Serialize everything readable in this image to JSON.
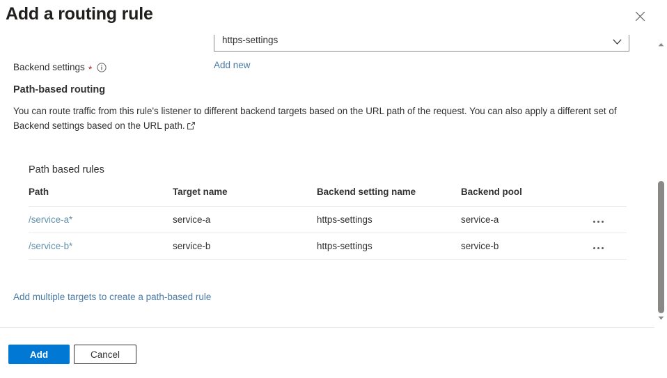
{
  "blade": {
    "title": "Add a routing rule",
    "close_icon": "close-icon"
  },
  "backend_settings": {
    "label": "Backend settings",
    "required_marker": "*",
    "info_icon": "info-icon",
    "dropdown_value": "https-settings",
    "dropdown_caret_icon": "chevron-down-icon",
    "add_new_label": "Add new"
  },
  "path_based_routing": {
    "heading": "Path-based routing",
    "description": "You can route traffic from this rule's listener to different backend targets based on the URL path of the request. You can also apply a different set of Backend settings based on the URL path.",
    "external_link_icon": "external-link-icon"
  },
  "rules": {
    "title": "Path based rules",
    "columns": [
      "Path",
      "Target name",
      "Backend setting name",
      "Backend pool"
    ],
    "rows": [
      {
        "path": "/service-a*",
        "target_name": "service-a",
        "backend_setting_name": "https-settings",
        "backend_pool": "service-a",
        "actions_icon": "more-options-icon"
      },
      {
        "path": "/service-b*",
        "target_name": "service-b",
        "backend_setting_name": "https-settings",
        "backend_pool": "service-b",
        "actions_icon": "more-options-icon"
      }
    ],
    "add_multiple_label": "Add multiple targets to create a path-based rule"
  },
  "scrollbar": {
    "up_arrow_icon": "scroll-up-arrow-icon",
    "down_arrow_icon": "scroll-down-arrow-icon"
  },
  "footer": {
    "add_label": "Add",
    "cancel_label": "Cancel"
  },
  "colors": {
    "primary": "#0078d4",
    "link": "#4a7ba6",
    "path_link": "#6391ab",
    "required": "#a4262c",
    "text": "#323130",
    "border": "#edebe9"
  }
}
